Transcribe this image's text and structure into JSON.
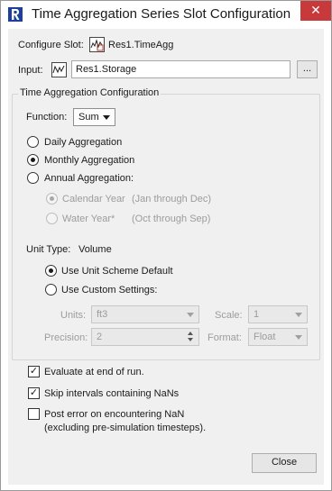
{
  "window": {
    "title": "Time Aggregation Series Slot Configuration",
    "close_glyph": "✕",
    "app_icon": "R"
  },
  "configure_slot": {
    "label": "Configure Slot:",
    "value": "Res1.TimeAgg",
    "icon": "time-aggregation-slot-icon"
  },
  "input": {
    "label": "Input:",
    "value": "Res1.Storage",
    "icon": "series-slot-icon",
    "browse_label": "..."
  },
  "group": {
    "title": "Time Aggregation Configuration",
    "function_label": "Function:",
    "function_value": "Sum",
    "aggregation": [
      {
        "label": "Daily Aggregation",
        "checked": false
      },
      {
        "label": "Monthly Aggregation",
        "checked": true
      },
      {
        "label": "Annual Aggregation:",
        "checked": false
      }
    ],
    "annual": [
      {
        "label": "Calendar Year",
        "note": "(Jan through Dec)",
        "checked": true
      },
      {
        "label": "Water Year*",
        "note": "(Oct through Sep)",
        "checked": false
      }
    ],
    "unit_type_label": "Unit Type:",
    "unit_type_value": "Volume",
    "unit_options": [
      {
        "label": "Use Unit Scheme Default",
        "checked": true
      },
      {
        "label": "Use Custom Settings:",
        "checked": false
      }
    ],
    "units_label": "Units:",
    "units_value": "ft3",
    "scale_label": "Scale:",
    "scale_value": "1",
    "precision_label": "Precision:",
    "precision_value": "2",
    "format_label": "Format:",
    "format_value": "Float"
  },
  "options": [
    {
      "label": "Evaluate at end of run.",
      "checked": true
    },
    {
      "label": "Skip intervals containing NaNs",
      "checked": true
    },
    {
      "label": "Post error on encountering NaN",
      "label2": "(excluding pre-simulation timesteps).",
      "checked": false
    }
  ],
  "close_button": "Close",
  "check_glyph": "✓"
}
